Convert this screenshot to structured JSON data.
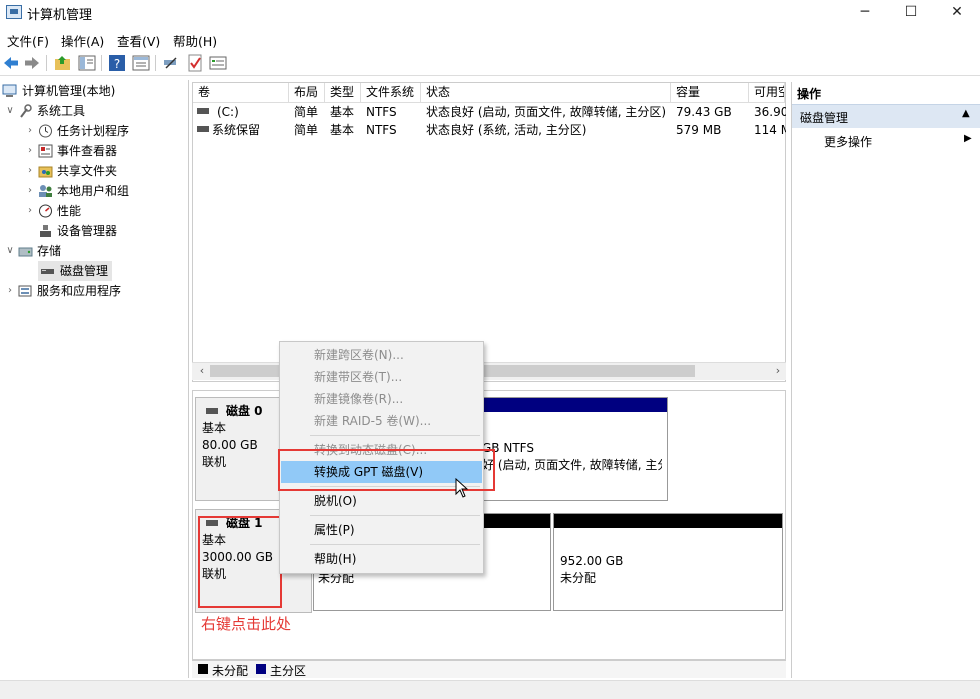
{
  "window": {
    "title": "计算机管理"
  },
  "menubar": [
    "文件(F)",
    "操作(A)",
    "查看(V)",
    "帮助(H)"
  ],
  "tree": {
    "root": "计算机管理(本地)",
    "system_tools": "系统工具",
    "task_scheduler": "任务计划程序",
    "event_viewer": "事件查看器",
    "shared_folders": "共享文件夹",
    "local_users": "本地用户和组",
    "performance": "性能",
    "device_manager": "设备管理器",
    "storage": "存储",
    "disk_management": "磁盘管理",
    "services_apps": "服务和应用程序"
  },
  "volume_table": {
    "columns": [
      "卷",
      "布局",
      "类型",
      "文件系统",
      "状态",
      "容量",
      "可用空"
    ],
    "rows": [
      [
        "(C:)",
        "简单",
        "基本",
        "NTFS",
        "状态良好 (启动, 页面文件, 故障转储, 主分区)",
        "79.43 GB",
        "36.90"
      ],
      [
        "系统保留",
        "简单",
        "基本",
        "NTFS",
        "状态良好 (系统, 活动, 主分区)",
        "579 MB",
        "114 M"
      ]
    ]
  },
  "disks": {
    "disk0": {
      "name": "磁盘 0",
      "type": "基本",
      "size": "80.00 GB",
      "status": "联机",
      "part_fs": "GB NTFS",
      "part_status": "好 (启动, 页面文件, 故障转储, 主分"
    },
    "disk1": {
      "name": "磁盘 1",
      "type": "基本",
      "size": "3000.00 GB",
      "status": "联机",
      "part1_label": "未分配",
      "part2_size": "952.00 GB",
      "part2_label": "未分配"
    }
  },
  "annotation": "右键点击此处",
  "legend": {
    "unallocated": "未分配",
    "primary": "主分区"
  },
  "actions": {
    "header": "操作",
    "section": "磁盘管理",
    "more": "更多操作"
  },
  "context_menu": {
    "new_spanned": "新建跨区卷(N)...",
    "new_striped": "新建带区卷(T)...",
    "new_mirrored": "新建镜像卷(R)...",
    "new_raid5": "新建 RAID-5 卷(W)...",
    "convert_dynamic": "转换到动态磁盘(C)...",
    "convert_gpt": "转换成 GPT 磁盘(V)",
    "offline": "脱机(O)",
    "properties": "属性(P)",
    "help": "帮助(H)"
  },
  "colors": {
    "unallocated": "#000000",
    "primary": "#000080",
    "highlight": "#cce8ff",
    "annotation": "#e53935"
  }
}
